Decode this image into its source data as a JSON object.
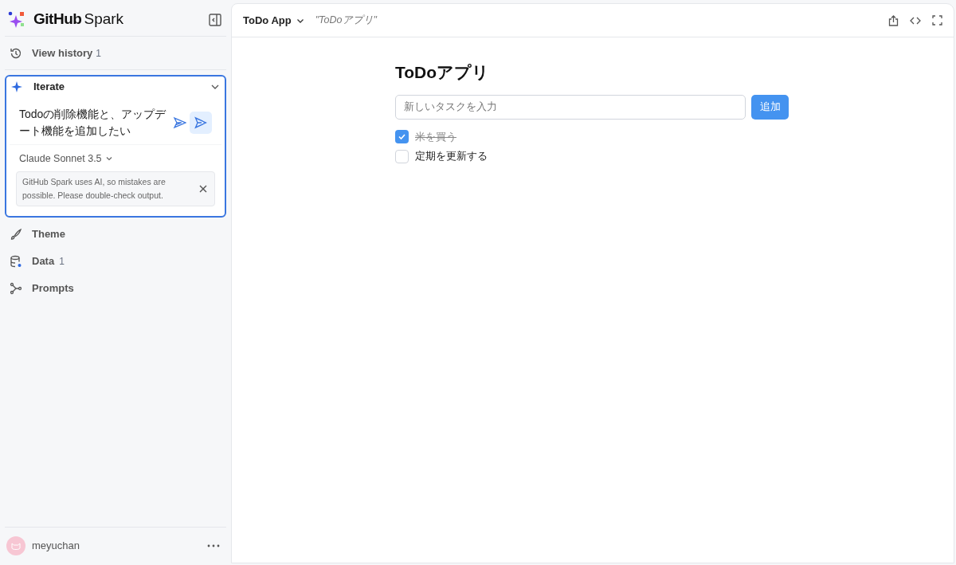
{
  "brand": {
    "bold": "GitHub",
    "light": "Spark"
  },
  "history": {
    "label": "View history",
    "count": "1"
  },
  "iterate": {
    "title": "Iterate",
    "expanded": true,
    "prompt": "Todoの削除機能と、アップデート機能を追加したい",
    "model": "Claude Sonnet 3.5",
    "notice": "GitHub Spark uses AI, so mistakes are possible. Please double-check output."
  },
  "nav": [
    {
      "kind": "theme",
      "label": "Theme"
    },
    {
      "kind": "data",
      "label": "Data",
      "count": "1"
    },
    {
      "kind": "prompts",
      "label": "Prompts"
    }
  ],
  "user": {
    "name": "meyuchan"
  },
  "header": {
    "app_name": "ToDo App",
    "title": "\"ToDoアプリ\""
  },
  "app": {
    "title": "ToDoアプリ",
    "placeholder": "新しいタスクを入力",
    "button": "追加",
    "todos": [
      {
        "text": "米を買う",
        "checked": true
      },
      {
        "text": "定期を更新する",
        "checked": false
      }
    ]
  }
}
